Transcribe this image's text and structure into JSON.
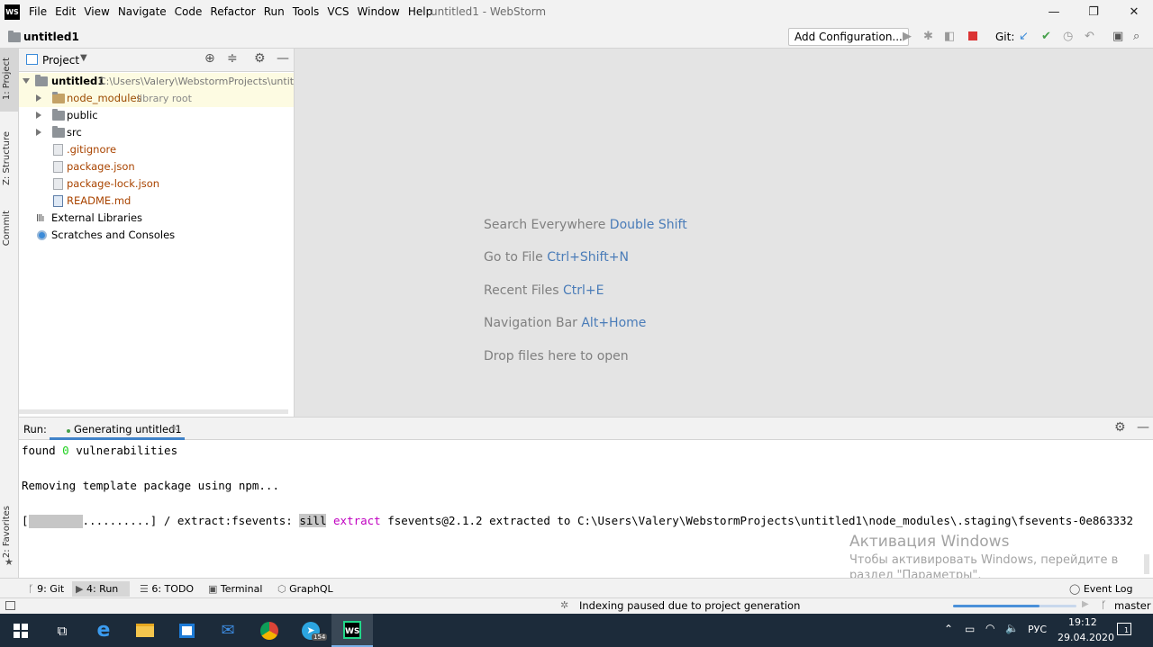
{
  "app": {
    "logo_text": "WS",
    "menu": [
      "File",
      "Edit",
      "View",
      "Navigate",
      "Code",
      "Refactor",
      "Run",
      "Tools",
      "VCS",
      "Window",
      "Help"
    ],
    "window_title": "untitled1 - WebStorm",
    "window_controls": {
      "minimize": "—",
      "maximize": "❐",
      "close": "✕"
    }
  },
  "navbar": {
    "project_name": "untitled1",
    "add_configuration": "Add Configuration...",
    "git_label": "Git:"
  },
  "left_strip": {
    "project_tab": "1: Project",
    "structure_tab": "Z: Structure",
    "commit_tab": "Commit",
    "favorites_tab": "2: Favorites"
  },
  "project_panel": {
    "title": "Project",
    "root": {
      "name": "untitled1",
      "path": "C:\\Users\\Valery\\WebstormProjects\\untitled"
    },
    "items": [
      {
        "name": "node_modules",
        "note": "library root",
        "kind": "folder",
        "color": "#9b4a00"
      },
      {
        "name": "public",
        "note": "",
        "kind": "folder",
        "color": "#000000"
      },
      {
        "name": "src",
        "note": "",
        "kind": "folder",
        "color": "#000000"
      },
      {
        "name": ".gitignore",
        "note": "",
        "kind": "file",
        "color": "#a94400"
      },
      {
        "name": "package.json",
        "note": "",
        "kind": "file",
        "color": "#a94400"
      },
      {
        "name": "package-lock.json",
        "note": "",
        "kind": "file",
        "color": "#a94400"
      },
      {
        "name": "README.md",
        "note": "",
        "kind": "md",
        "color": "#a94400"
      },
      {
        "name": "External Libraries",
        "note": "",
        "kind": "libs",
        "color": "#000000"
      },
      {
        "name": "Scratches and Consoles",
        "note": "",
        "kind": "scratch",
        "color": "#000000"
      }
    ]
  },
  "editor_hints": [
    {
      "text": "Search Everywhere",
      "key": "Double Shift"
    },
    {
      "text": "Go to File",
      "key": "Ctrl+Shift+N"
    },
    {
      "text": "Recent Files",
      "key": "Ctrl+E"
    },
    {
      "text": "Navigation Bar",
      "key": "Alt+Home"
    },
    {
      "text": "Drop files here to open",
      "key": ""
    }
  ],
  "run_panel": {
    "label": "Run:",
    "tab": "Generating untitled1",
    "console": {
      "line1_a": "found ",
      "line1_num": "0",
      "line1_b": " vulnerabilities",
      "line2": "Removing template package using npm...",
      "line3_progress": "..........",
      "line3_a": "] / extract:fsevents: ",
      "line3_sill": "sill",
      "line3_extract": "extract",
      "line3_b": " fsevents@2.1.2 extracted to C:\\Users\\Valery\\WebstormProjects\\untitled1\\node_modules\\.staging\\fsevents-0e863332"
    }
  },
  "watermark": {
    "title": "Активация Windows",
    "line1": "Чтобы активировать Windows, перейдите в",
    "line2": "раздел \"Параметры\"."
  },
  "bottom_tabs": {
    "git": "9: Git",
    "run": "4: Run",
    "todo": "6: TODO",
    "terminal": "Terminal",
    "graphql": "GraphQL",
    "event_log": "Event Log"
  },
  "status": {
    "message": "Indexing paused due to project generation",
    "branch": "master"
  },
  "taskbar": {
    "lang": "РУС",
    "time": "19:12",
    "date": "29.04.2020",
    "telegram_badge": "154",
    "notifications": "1"
  }
}
